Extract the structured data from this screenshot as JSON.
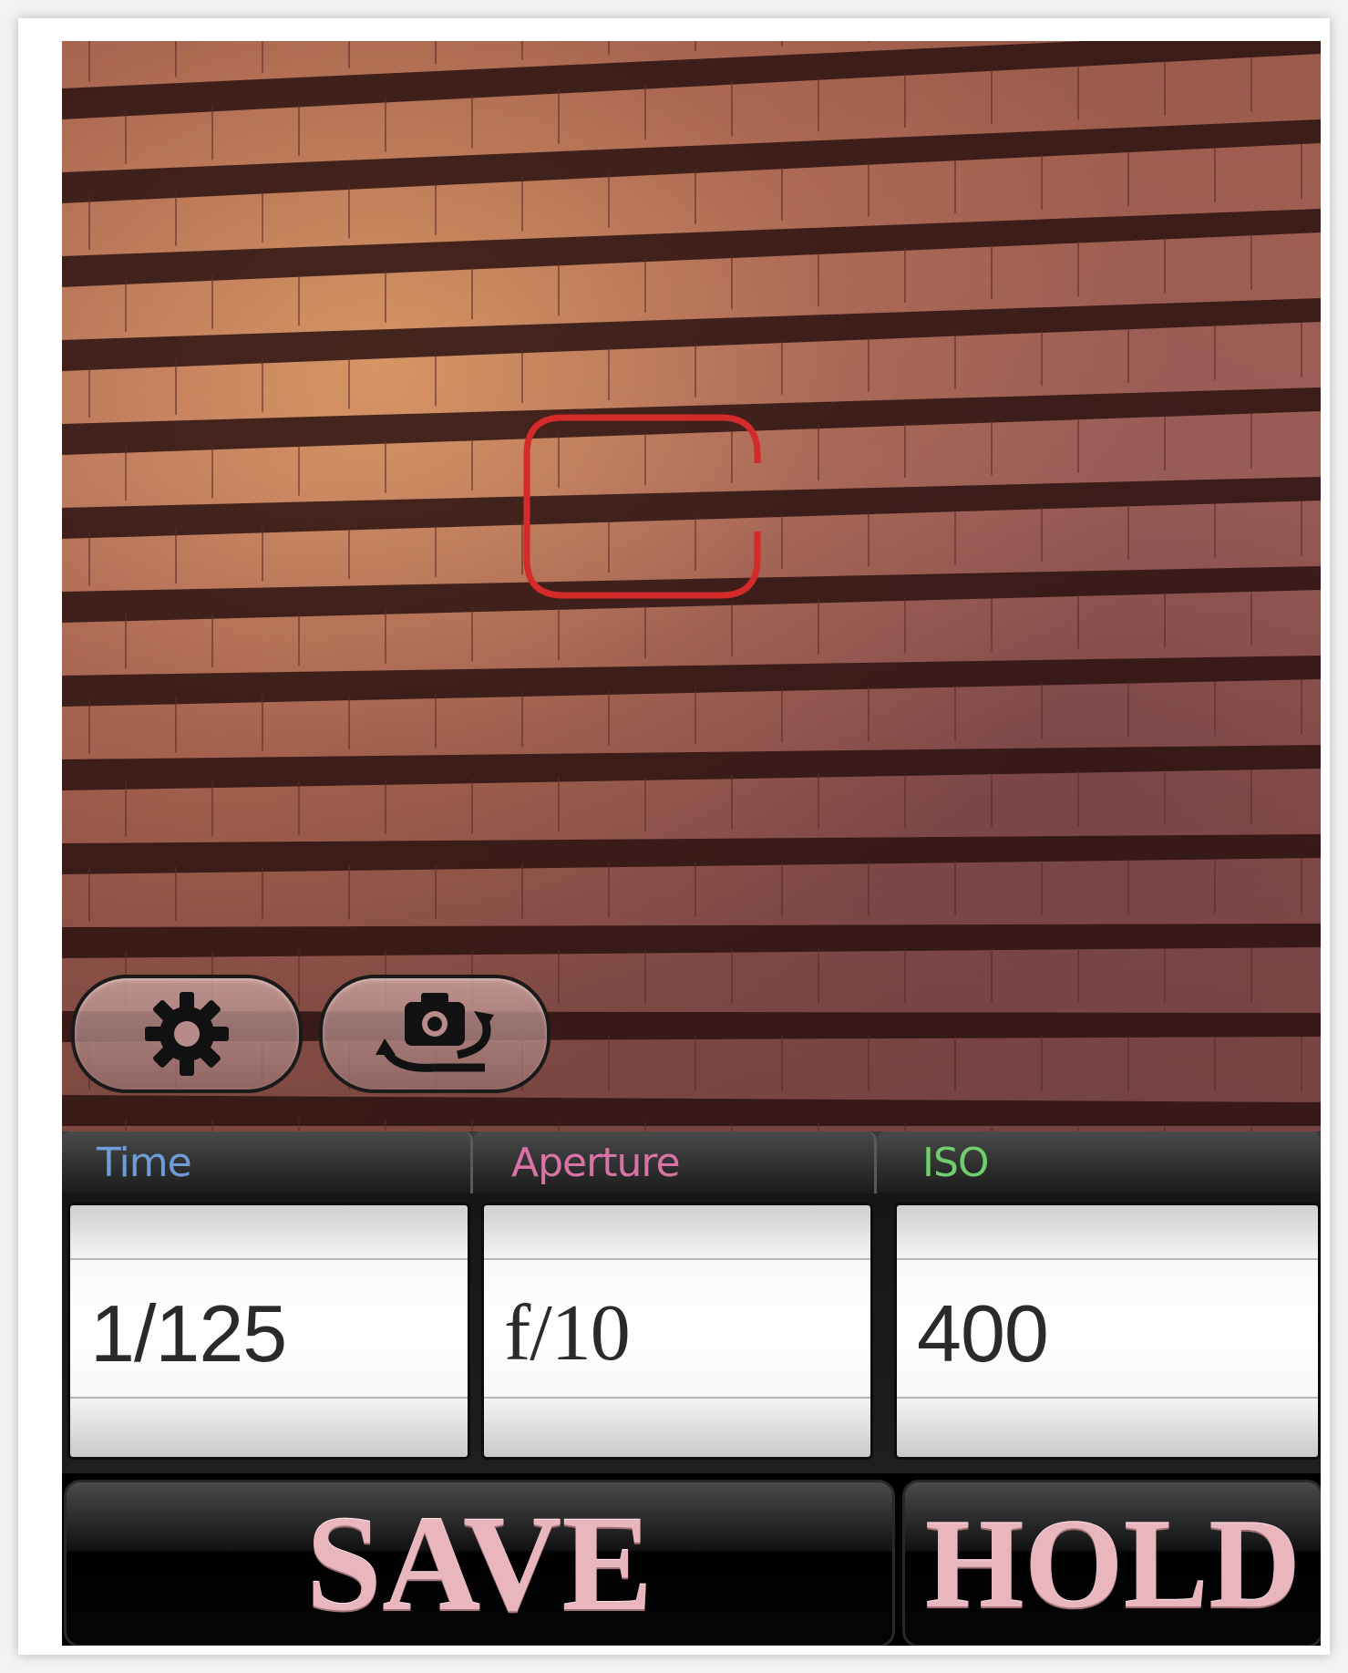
{
  "picker": {
    "time": {
      "label": "Time",
      "value": "1/125",
      "color": "#6f9cd8"
    },
    "aperture": {
      "label": "Aperture",
      "value": "f/10",
      "color": "#d873a6"
    },
    "iso": {
      "label": "ISO",
      "value": "400",
      "color": "#6fcf6f"
    }
  },
  "buttons": {
    "save_label": "SAVE",
    "hold_label": "HOLD",
    "settings_icon": "gear-icon",
    "switch_camera_icon": "camera-switch-icon"
  },
  "focus_indicator_color": "#d42a2a"
}
